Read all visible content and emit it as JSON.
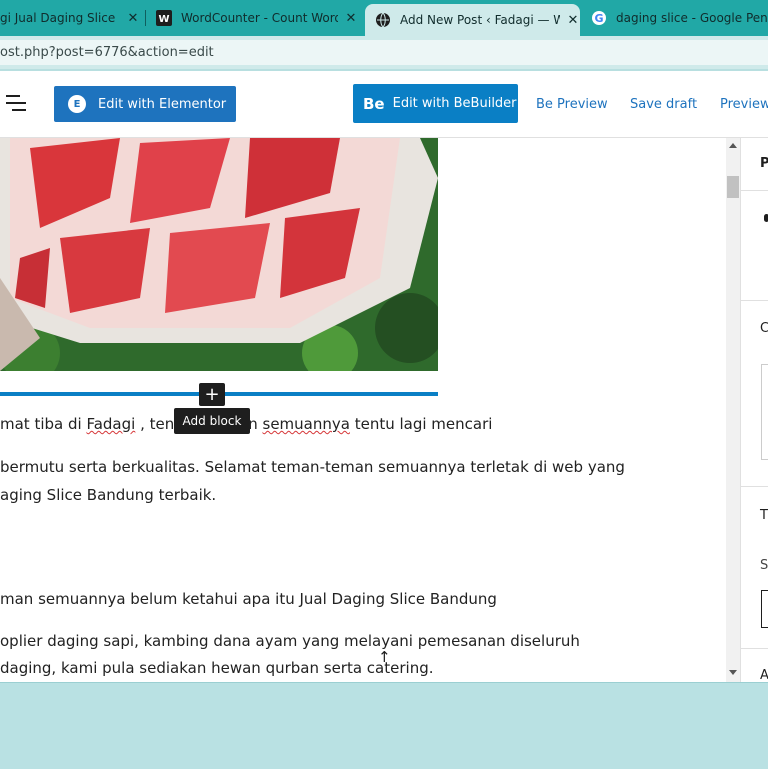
{
  "browser": {
    "tabs": [
      {
        "title": "gi Jual Daging Slice B",
        "icon": "page-icon"
      },
      {
        "title": "WordCounter - Count Words",
        "icon": "wordcounter-icon"
      },
      {
        "title": "Add New Post ‹ Fadagi — W",
        "icon": "globe-icon",
        "active": true
      },
      {
        "title": "daging slice - Google Penelu",
        "icon": "google-icon"
      }
    ],
    "close_symbol": "✕",
    "address": "ost.php?post=6776&action=edit"
  },
  "toolbar": {
    "elementor_label": "Edit with Elementor",
    "elementor_logo": "E",
    "bebuilder_logo": "Be",
    "bebuilder_label": "Edit with BeBuilder",
    "be_preview_label": "Be Preview",
    "save_draft_label": "Save draft",
    "preview_label": "Preview"
  },
  "editor": {
    "add_block_symbol": "+",
    "add_block_tooltip": "Add block",
    "para1_a": "mat tiba di ",
    "para1_link": "Fadagi",
    "para1_b": " , ten",
    "para1_c": "n ",
    "para1_d": "semuannya",
    "para1_e": " tentu lagi mencari",
    "para2_line1": " bermutu serta berkualitas. Selamat teman-teman semuannya terletak di web yang",
    "para2_line2": "aging Slice Bandung terbaik.",
    "para3": "man semuannya belum ketahui apa itu Jual Daging Slice Bandung",
    "para4_line1": "oplier daging sapi, kambing dana ayam yang melayani pemesanan diseluruh",
    "para4_line2": "daging, kami pula sediakan hewan qurban serta catering.",
    "scroll_arrow": "↑"
  },
  "sidebar": {
    "items": [
      "P",
      "C",
      "T",
      "S",
      "A"
    ]
  },
  "colors": {
    "tab_strip": "#21a8a6",
    "elementor_blue": "#1e73be",
    "bebuilder_blue": "#0a7fc5",
    "link_blue": "#1e73be",
    "footer": "#b9e1e3"
  }
}
